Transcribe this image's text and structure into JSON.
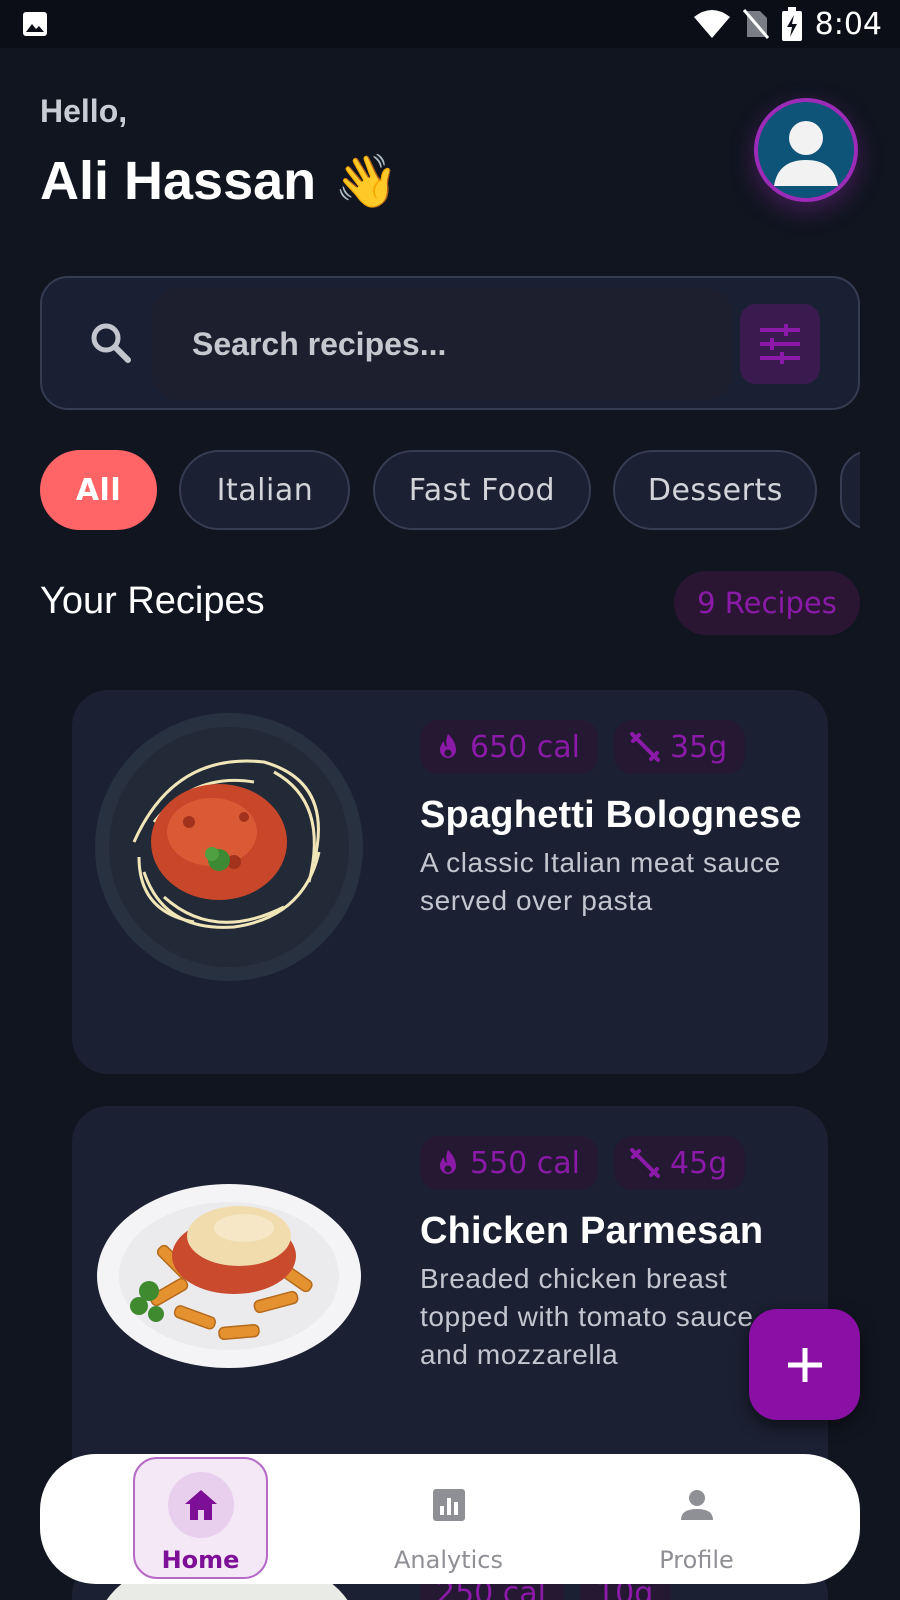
{
  "status_bar": {
    "time": "8:04"
  },
  "header": {
    "greeting": "Hello,",
    "name": "Ali Hassan",
    "wave_emoji": "👋"
  },
  "search": {
    "placeholder": "Search recipes...",
    "search_icon": "search-icon",
    "filter_icon": "tune-icon"
  },
  "categories": [
    "All",
    "Italian",
    "Fast Food",
    "Desserts"
  ],
  "recipes_section": {
    "title": "Your Recipes",
    "count_label": "9 Recipes"
  },
  "recipes": [
    {
      "calories": "650 cal",
      "protein": "35g",
      "title": "Spaghetti Bolognese",
      "description": "A classic Italian meat sauce served over pasta"
    },
    {
      "calories": "550 cal",
      "protein": "45g",
      "title": "Chicken Parmesan",
      "description": "Breaded chicken breast topped with tomato sauce and mozzarella"
    },
    {
      "calories": "250 cal",
      "protein": "10g"
    }
  ],
  "fab": {
    "icon": "plus-icon"
  },
  "bottom_nav": {
    "items": [
      {
        "label": "Home",
        "icon": "home-icon",
        "active": true
      },
      {
        "label": "Analytics",
        "icon": "analytics-icon",
        "active": false
      },
      {
        "label": "Profile",
        "icon": "person-icon",
        "active": false
      }
    ]
  },
  "colors": {
    "background": "#111520",
    "card": "#1b2032",
    "accent_purple": "#8a0fa5",
    "active_chip": "#ff6467"
  }
}
